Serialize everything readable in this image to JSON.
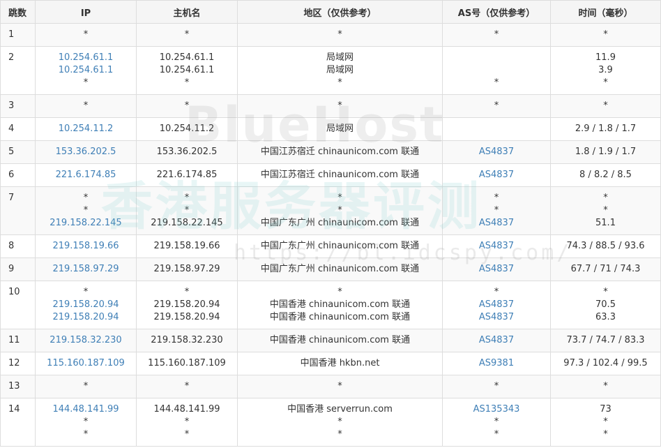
{
  "table": {
    "headers": [
      "跳数",
      "IP",
      "主机名",
      "地区（仅供参考）",
      "AS号（仅供参考）",
      "时间（毫秒）"
    ],
    "rows": [
      {
        "hop": "1",
        "ip": [
          "*"
        ],
        "host": [
          "*"
        ],
        "region": [
          "*"
        ],
        "as": [
          "*"
        ],
        "time": [
          "*"
        ]
      },
      {
        "hop": "2",
        "ip": [
          "10.254.61.1",
          "10.254.61.1",
          "*"
        ],
        "host": [
          "10.254.61.1",
          "10.254.61.1",
          "*"
        ],
        "region": [
          "局域网",
          "局域网",
          "*"
        ],
        "as": [
          "",
          "",
          "*"
        ],
        "time": [
          "11.9",
          "3.9",
          "*"
        ]
      },
      {
        "hop": "3",
        "ip": [
          "*"
        ],
        "host": [
          "*"
        ],
        "region": [
          "*"
        ],
        "as": [
          "*"
        ],
        "time": [
          "*"
        ]
      },
      {
        "hop": "4",
        "ip": [
          "10.254.11.2"
        ],
        "host": [
          "10.254.11.2"
        ],
        "region": [
          "局域网"
        ],
        "as": [
          ""
        ],
        "time": [
          "2.9 / 1.8 / 1.7"
        ]
      },
      {
        "hop": "5",
        "ip": [
          "153.36.202.5"
        ],
        "host": [
          "153.36.202.5"
        ],
        "region": [
          "中国江苏宿迁 chinaunicom.com 联通"
        ],
        "as": [
          "AS4837"
        ],
        "time": [
          "1.8 / 1.9 / 1.7"
        ]
      },
      {
        "hop": "6",
        "ip": [
          "221.6.174.85"
        ],
        "host": [
          "221.6.174.85"
        ],
        "region": [
          "中国江苏宿迁 chinaunicom.com 联通"
        ],
        "as": [
          "AS4837"
        ],
        "time": [
          "8 / 8.2 / 8.5"
        ]
      },
      {
        "hop": "7",
        "ip": [
          "*",
          "*",
          "219.158.22.145"
        ],
        "host": [
          "*",
          "*",
          "219.158.22.145"
        ],
        "region": [
          "*",
          "*",
          "中国广东广州 chinaunicom.com 联通"
        ],
        "as": [
          "*",
          "*",
          "AS4837"
        ],
        "time": [
          "*",
          "*",
          "51.1"
        ]
      },
      {
        "hop": "8",
        "ip": [
          "219.158.19.66"
        ],
        "host": [
          "219.158.19.66"
        ],
        "region": [
          "中国广东广州 chinaunicom.com 联通"
        ],
        "as": [
          "AS4837"
        ],
        "time": [
          "74.3 / 88.5 / 93.6"
        ]
      },
      {
        "hop": "9",
        "ip": [
          "219.158.97.29"
        ],
        "host": [
          "219.158.97.29"
        ],
        "region": [
          "中国广东广州 chinaunicom.com 联通"
        ],
        "as": [
          "AS4837"
        ],
        "time": [
          "67.7 / 71 / 74.3"
        ]
      },
      {
        "hop": "10",
        "ip": [
          "*",
          "219.158.20.94",
          "219.158.20.94"
        ],
        "host": [
          "*",
          "219.158.20.94",
          "219.158.20.94"
        ],
        "region": [
          "*",
          "中国香港 chinaunicom.com 联通",
          "中国香港 chinaunicom.com 联通"
        ],
        "as": [
          "*",
          "AS4837",
          "AS4837"
        ],
        "time": [
          "*",
          "70.5",
          "63.3"
        ]
      },
      {
        "hop": "11",
        "ip": [
          "219.158.32.230"
        ],
        "host": [
          "219.158.32.230"
        ],
        "region": [
          "中国香港 chinaunicom.com 联通"
        ],
        "as": [
          "AS4837"
        ],
        "time": [
          "73.7 / 74.7 / 83.3"
        ]
      },
      {
        "hop": "12",
        "ip": [
          "115.160.187.109"
        ],
        "host": [
          "115.160.187.109"
        ],
        "region": [
          "中国香港 hkbn.net"
        ],
        "as": [
          "AS9381"
        ],
        "time": [
          "97.3 / 102.4 / 99.5"
        ]
      },
      {
        "hop": "13",
        "ip": [
          "*"
        ],
        "host": [
          "*"
        ],
        "region": [
          "*"
        ],
        "as": [
          "*"
        ],
        "time": [
          "*"
        ]
      },
      {
        "hop": "14",
        "ip": [
          "144.48.141.99",
          "*",
          "*"
        ],
        "host": [
          "144.48.141.99",
          "*",
          "*"
        ],
        "region": [
          "中国香港 serverrun.com",
          "*",
          "*"
        ],
        "as": [
          "AS135343",
          "*",
          "*"
        ],
        "time": [
          "73",
          "*",
          "*"
        ]
      }
    ]
  },
  "watermark": {
    "brand": "BlueHost",
    "subtitle": "香港服务器评测",
    "url": "https://bl.idcspy.com/"
  },
  "colors": {
    "link": "#3f7fb6",
    "text": "#333333",
    "border": "#dddddd",
    "header_bg": "#f5f5f5",
    "stripe_bg": "#f9f9f9"
  }
}
